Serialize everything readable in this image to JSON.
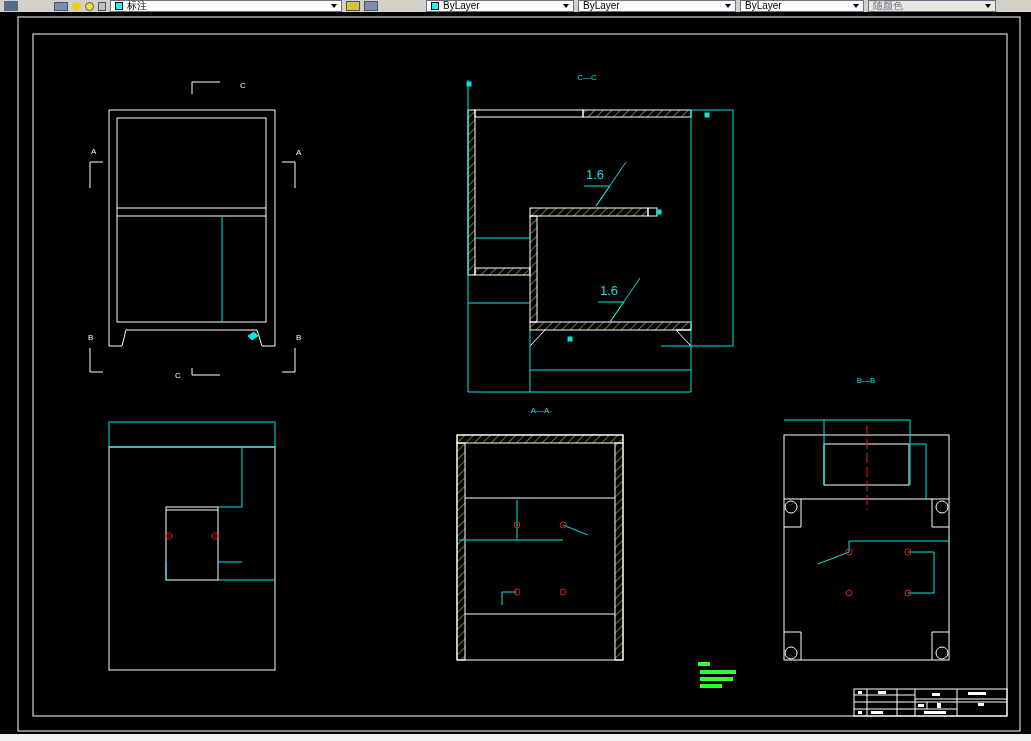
{
  "toolbar": {
    "layer": "标注",
    "color_setting": "ByLayer",
    "linetype": "ByLayer",
    "lineweight": "ByLayer",
    "plot_style": {
      "text": "随颜色",
      "disabled": true
    }
  },
  "drawing": {
    "section_marks": [
      "C",
      "A",
      "A",
      "B",
      "B",
      "C"
    ],
    "view_titles": [
      "C—C",
      "A—A",
      "B—B"
    ],
    "roughness": [
      "1.6",
      "1.6"
    ]
  }
}
